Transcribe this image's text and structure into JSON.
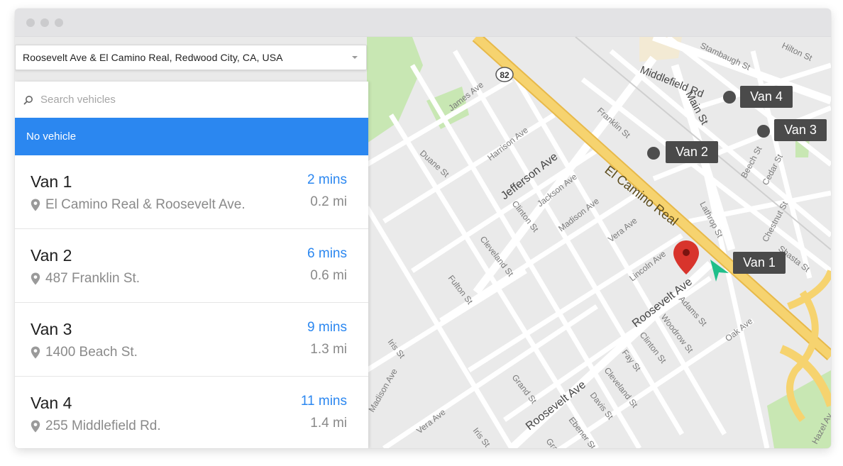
{
  "address": {
    "value": "Roosevelt Ave & El Camino Real, Redwood City, CA, USA"
  },
  "search": {
    "placeholder": "Search vehicles"
  },
  "selection": {
    "label": "No vehicle"
  },
  "vehicles": [
    {
      "name": "Van 1",
      "address": "El Camino Real & Roosevelt Ave.",
      "eta": "2 mins",
      "distance": "0.2 mi"
    },
    {
      "name": "Van 2",
      "address": "487 Franklin St.",
      "eta": "6 mins",
      "distance": "0.6 mi"
    },
    {
      "name": "Van 3",
      "address": "1400 Beach St.",
      "eta": "9 mins",
      "distance": "1.3 mi"
    },
    {
      "name": "Van 4",
      "address": "255 Middlefield Rd.",
      "eta": "11 mins",
      "distance": "1.4 mi"
    }
  ],
  "map": {
    "route_shield": "82",
    "van_markers": [
      "Van 1",
      "Van 2",
      "Van 3",
      "Van 4"
    ],
    "streets": {
      "el_camino": "El Camino Real",
      "roosevelt": "Roosevelt Ave",
      "roosevelt2": "Roosevelt Ave",
      "jefferson": "Jefferson Ave",
      "middlefield": "Middlefield Rd",
      "main": "Main St",
      "franklin": "Franklin St",
      "harrison": "Harrison Ave",
      "james": "James Ave",
      "jackson": "Jackson Ave",
      "madison": "Madison Ave",
      "madison2": "Madison Ave",
      "clinton": "Clinton St",
      "clinton2": "Clinton St",
      "duane": "Duane St",
      "cleveland": "Cleveland St",
      "cleveland2": "Cleveland St",
      "fulton": "Fulton St",
      "vera": "Vera Ave",
      "vera2": "Vera Ave",
      "lincoln": "Lincoln Ave",
      "lathrop": "Lathrop St",
      "adams": "Adams St",
      "woodrow": "Woodrow St",
      "fay": "Fay St",
      "oak": "Oak Ave",
      "grand": "Grand St",
      "grand2": "Grand",
      "davis": "Davis St",
      "ebener": "Ebener St",
      "iris": "Iris St",
      "iris2": "Iris St",
      "beech": "Beech St",
      "cedar": "Cedar St",
      "chestnut": "Chestnut St",
      "shasta": "Shasta St",
      "stambaugh": "Stambaugh St",
      "hilton": "Hilton St",
      "hazel": "Hazel Av"
    }
  },
  "colors": {
    "accent": "#2b87f0",
    "highway": "#f6d36f",
    "map_bg": "#eaeaea",
    "park": "#c8e7b3",
    "pin": "#d8342c",
    "van_label_bg": "#4a4a4a",
    "navigation_arrow": "#1fbf8a"
  },
  "icons": {
    "search": "search-icon",
    "location": "map-pin-icon",
    "dropdown": "chevron-down-icon",
    "destination": "map-marker-icon",
    "navigation": "navigation-arrow-icon"
  }
}
